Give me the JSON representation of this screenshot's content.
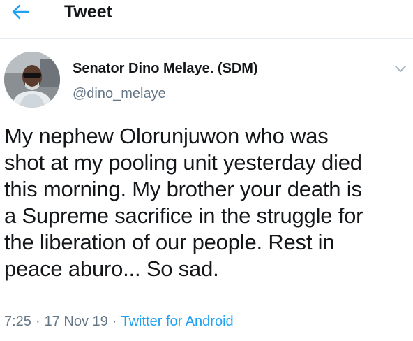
{
  "header": {
    "title": "Tweet",
    "back_icon": "arrow-left-icon",
    "accent_color": "#1da1f2"
  },
  "tweet": {
    "author_name": "Senator Dino Melaye. (SDM)",
    "author_handle": "@dino_melaye",
    "menu_icon": "chevron-down-icon",
    "text_lines": [
      "My nephew Olorunjuwon who was",
      "shot at my pooling unit yesterday died",
      "this morning. My brother your death is",
      "a Supreme sacrifice in the struggle for",
      "the liberation of our people. Rest in",
      "peace aburo... So sad."
    ],
    "time": "7:25",
    "separator": "·",
    "date": "17 Nov 19",
    "source": "Twitter for Android"
  }
}
